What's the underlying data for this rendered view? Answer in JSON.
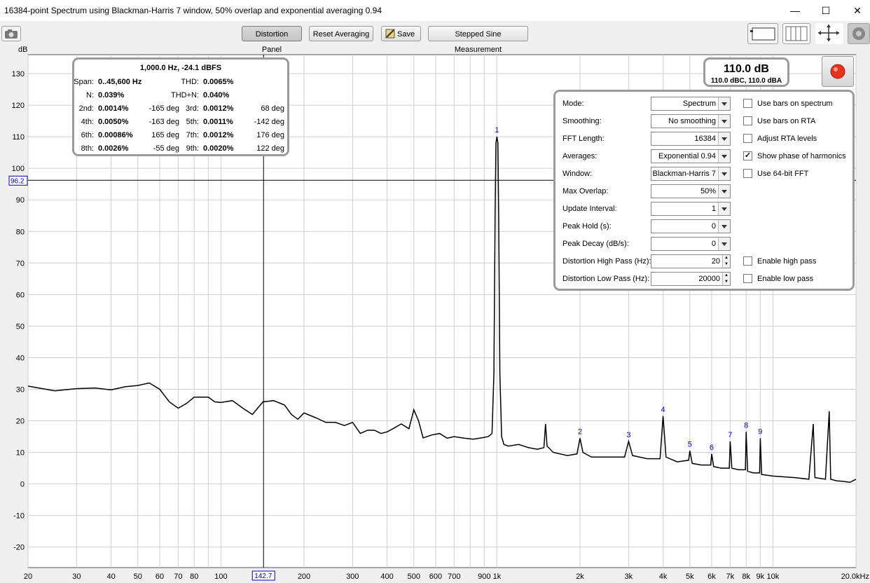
{
  "window": {
    "title": "16384-point Spectrum using Blackman-Harris 7 window, 50% overlap and exponential averaging 0.94",
    "minimize": "—",
    "maximize": "☐",
    "close": "✕"
  },
  "toolbar": {
    "distortion_panel": "Distortion Panel",
    "reset_averaging": "Reset Averaging",
    "save": "Save",
    "stepped_sine": "Stepped Sine Measurement"
  },
  "plot": {
    "y_unit": "dB",
    "cursor_db": "96.2",
    "cursor_freq": "142.7"
  },
  "distortion": {
    "header": "1,000.0 Hz, -24.1 dBFS",
    "rows": [
      [
        {
          "l": "Span:",
          "v": "0..45,600 Hz"
        },
        {
          "l": "THD:",
          "v": "0.0065%"
        }
      ],
      [
        {
          "l": "N:",
          "v": "0.039%"
        },
        {
          "l": "THD+N:",
          "v": "0.040%"
        }
      ],
      [
        {
          "l": "2nd:",
          "v": "0.0014%",
          "d": "-165 deg"
        },
        {
          "l": "3rd:",
          "v": "0.0012%",
          "d": "68 deg"
        }
      ],
      [
        {
          "l": "4th:",
          "v": "0.0050%",
          "d": "-163 deg"
        },
        {
          "l": "5th:",
          "v": "0.0011%",
          "d": "-142 deg"
        }
      ],
      [
        {
          "l": "6th:",
          "v": "0.00086%",
          "d": "165 deg"
        },
        {
          "l": "7th:",
          "v": "0.0012%",
          "d": "176 deg"
        }
      ],
      [
        {
          "l": "8th:",
          "v": "0.0026%",
          "d": "-55 deg"
        },
        {
          "l": "9th:",
          "v": "0.0020%",
          "d": "122 deg"
        }
      ]
    ]
  },
  "level": {
    "main": "110.0 dB",
    "sub": "110.0 dBC, 110.0 dBA"
  },
  "settings": {
    "controls": [
      {
        "label": "Mode:",
        "value": "Spectrum",
        "kind": "select"
      },
      {
        "label": "Smoothing:",
        "value": "No  smoothing",
        "kind": "select"
      },
      {
        "label": "FFT Length:",
        "value": "16384",
        "kind": "select"
      },
      {
        "label": "Averages:",
        "value": "Exponential 0.94",
        "kind": "select"
      },
      {
        "label": "Window:",
        "value": "Blackman-Harris 7",
        "kind": "select"
      },
      {
        "label": "Max Overlap:",
        "value": "50%",
        "kind": "select"
      },
      {
        "label": "Update Interval:",
        "value": "1",
        "kind": "select"
      },
      {
        "label": "Peak Hold (s):",
        "value": "0",
        "kind": "select"
      },
      {
        "label": "Peak Decay (dB/s):",
        "value": "0",
        "kind": "select"
      },
      {
        "label": "Distortion High Pass (Hz):",
        "value": "20",
        "kind": "spin"
      },
      {
        "label": "Distortion Low Pass (Hz):",
        "value": "20000",
        "kind": "spin"
      }
    ],
    "checkboxes": [
      {
        "label": "Use bars on spectrum",
        "checked": false,
        "row": 0
      },
      {
        "label": "Use bars on RTA",
        "checked": false,
        "row": 1
      },
      {
        "label": "Adjust RTA levels",
        "checked": false,
        "row": 2
      },
      {
        "label": "Show phase of harmonics",
        "checked": true,
        "row": 3
      },
      {
        "label": "Use 64-bit FFT",
        "checked": false,
        "row": 4
      },
      {
        "label": "Enable high pass",
        "checked": false,
        "row": 9
      },
      {
        "label": "Enable low pass",
        "checked": false,
        "row": 10
      }
    ]
  },
  "chart_data": {
    "type": "line",
    "ylabel": "dB",
    "ylim": [
      -25,
      135
    ],
    "xlim": [
      20,
      20000
    ],
    "x_scale": "log",
    "y_ticks": [
      130,
      120,
      110,
      100,
      90,
      80,
      70,
      60,
      50,
      40,
      30,
      20,
      10,
      0,
      -10,
      -20
    ],
    "x_tick_labels": [
      {
        "f": 20,
        "t": "20"
      },
      {
        "f": 30,
        "t": "30"
      },
      {
        "f": 40,
        "t": "40"
      },
      {
        "f": 50,
        "t": "50"
      },
      {
        "f": 60,
        "t": "60"
      },
      {
        "f": 70,
        "t": "70"
      },
      {
        "f": 80,
        "t": "80"
      },
      {
        "f": 100,
        "t": "100"
      },
      {
        "f": 200,
        "t": "200"
      },
      {
        "f": 300,
        "t": "300"
      },
      {
        "f": 400,
        "t": "400"
      },
      {
        "f": 500,
        "t": "500"
      },
      {
        "f": 600,
        "t": "600"
      },
      {
        "f": 700,
        "t": "700"
      },
      {
        "f": 900,
        "t": "900"
      },
      {
        "f": 1000,
        "t": "1k"
      },
      {
        "f": 2000,
        "t": "2k"
      },
      {
        "f": 3000,
        "t": "3k"
      },
      {
        "f": 4000,
        "t": "4k"
      },
      {
        "f": 5000,
        "t": "5k"
      },
      {
        "f": 6000,
        "t": "6k"
      },
      {
        "f": 7000,
        "t": "7k"
      },
      {
        "f": 8000,
        "t": "8k"
      },
      {
        "f": 9000,
        "t": "9k"
      },
      {
        "f": 10000,
        "t": "10k"
      },
      {
        "f": 20000,
        "t": "20.0kHz"
      }
    ],
    "series": [
      {
        "points": [
          [
            20,
            31
          ],
          [
            25,
            29.5
          ],
          [
            30,
            30.2
          ],
          [
            35,
            30.4
          ],
          [
            40,
            29.8
          ],
          [
            45,
            30.8
          ],
          [
            50,
            31.2
          ],
          [
            55,
            32
          ],
          [
            60,
            30
          ],
          [
            65,
            26
          ],
          [
            70,
            24
          ],
          [
            75,
            25.5
          ],
          [
            80,
            27.5
          ],
          [
            85,
            27.5
          ],
          [
            90,
            27.5
          ],
          [
            95,
            26
          ],
          [
            100,
            25.8
          ],
          [
            110,
            26.4
          ],
          [
            120,
            24
          ],
          [
            130,
            22
          ],
          [
            142,
            26
          ],
          [
            155,
            26.4
          ],
          [
            170,
            25
          ],
          [
            180,
            22
          ],
          [
            190,
            20.5
          ],
          [
            200,
            22.5
          ],
          [
            220,
            21
          ],
          [
            240,
            19.5
          ],
          [
            260,
            19.5
          ],
          [
            280,
            18.5
          ],
          [
            300,
            19.5
          ],
          [
            320,
            16
          ],
          [
            340,
            17
          ],
          [
            360,
            17
          ],
          [
            380,
            16
          ],
          [
            400,
            16.5
          ],
          [
            420,
            17.5
          ],
          [
            450,
            19
          ],
          [
            480,
            17.5
          ],
          [
            500,
            23.5
          ],
          [
            520,
            20
          ],
          [
            540,
            14.6
          ],
          [
            580,
            15.5
          ],
          [
            620,
            16
          ],
          [
            660,
            14.5
          ],
          [
            700,
            15
          ],
          [
            760,
            14.5
          ],
          [
            820,
            14.2
          ],
          [
            880,
            14.6
          ],
          [
            930,
            15
          ],
          [
            960,
            16
          ],
          [
            975,
            35
          ],
          [
            985,
            85
          ],
          [
            992,
            108
          ],
          [
            1000,
            110
          ],
          [
            1008,
            108
          ],
          [
            1015,
            85
          ],
          [
            1025,
            35
          ],
          [
            1040,
            15
          ],
          [
            1060,
            12.5
          ],
          [
            1100,
            12
          ],
          [
            1200,
            12.5
          ],
          [
            1300,
            11.5
          ],
          [
            1400,
            11
          ],
          [
            1480,
            11.5
          ],
          [
            1500,
            19
          ],
          [
            1520,
            12
          ],
          [
            1600,
            10
          ],
          [
            1800,
            9
          ],
          [
            1950,
            9.5
          ],
          [
            2000,
            14.5
          ],
          [
            2050,
            10
          ],
          [
            2200,
            8.5
          ],
          [
            2500,
            8.5
          ],
          [
            2900,
            8.5
          ],
          [
            3000,
            13.5
          ],
          [
            3100,
            9
          ],
          [
            3500,
            8
          ],
          [
            3900,
            8
          ],
          [
            4000,
            21.5
          ],
          [
            4100,
            8.5
          ],
          [
            4500,
            7
          ],
          [
            4950,
            7.5
          ],
          [
            5000,
            10.5
          ],
          [
            5100,
            6.5
          ],
          [
            5500,
            6
          ],
          [
            5950,
            6
          ],
          [
            6000,
            9.5
          ],
          [
            6100,
            5.5
          ],
          [
            6500,
            5
          ],
          [
            6950,
            5
          ],
          [
            7000,
            13.5
          ],
          [
            7100,
            5
          ],
          [
            7500,
            4.5
          ],
          [
            7950,
            4.5
          ],
          [
            8000,
            16.5
          ],
          [
            8100,
            4
          ],
          [
            8500,
            3.5
          ],
          [
            8950,
            3.5
          ],
          [
            9000,
            14.5
          ],
          [
            9100,
            3
          ],
          [
            10000,
            2.5
          ],
          [
            12000,
            2
          ],
          [
            13500,
            1.5
          ],
          [
            14000,
            19
          ],
          [
            14200,
            2
          ],
          [
            15500,
            1.5
          ],
          [
            16000,
            23
          ],
          [
            16200,
            1.5
          ],
          [
            17000,
            1
          ],
          [
            18000,
            0.8
          ],
          [
            19000,
            0.5
          ],
          [
            20000,
            1.5
          ]
        ]
      }
    ],
    "harmonic_markers": [
      {
        "f": 1000,
        "db": 110,
        "label": "1"
      },
      {
        "f": 2000,
        "db": 14.5,
        "label": "2"
      },
      {
        "f": 3000,
        "db": 13.5,
        "label": "3"
      },
      {
        "f": 4000,
        "db": 21.5,
        "label": "4"
      },
      {
        "f": 5000,
        "db": 10.5,
        "label": "5"
      },
      {
        "f": 6000,
        "db": 9.5,
        "label": "6"
      },
      {
        "f": 7000,
        "db": 13.5,
        "label": "7"
      },
      {
        "f": 8000,
        "db": 16.5,
        "label": "8"
      },
      {
        "f": 9000,
        "db": 14.5,
        "label": "9"
      }
    ],
    "cursor": {
      "f": 142.7,
      "db": 96.2
    }
  },
  "colors": {
    "marker": "#0000cc",
    "trace": "#000000",
    "grid": "#cfcfcf",
    "record": "#e8321e"
  }
}
